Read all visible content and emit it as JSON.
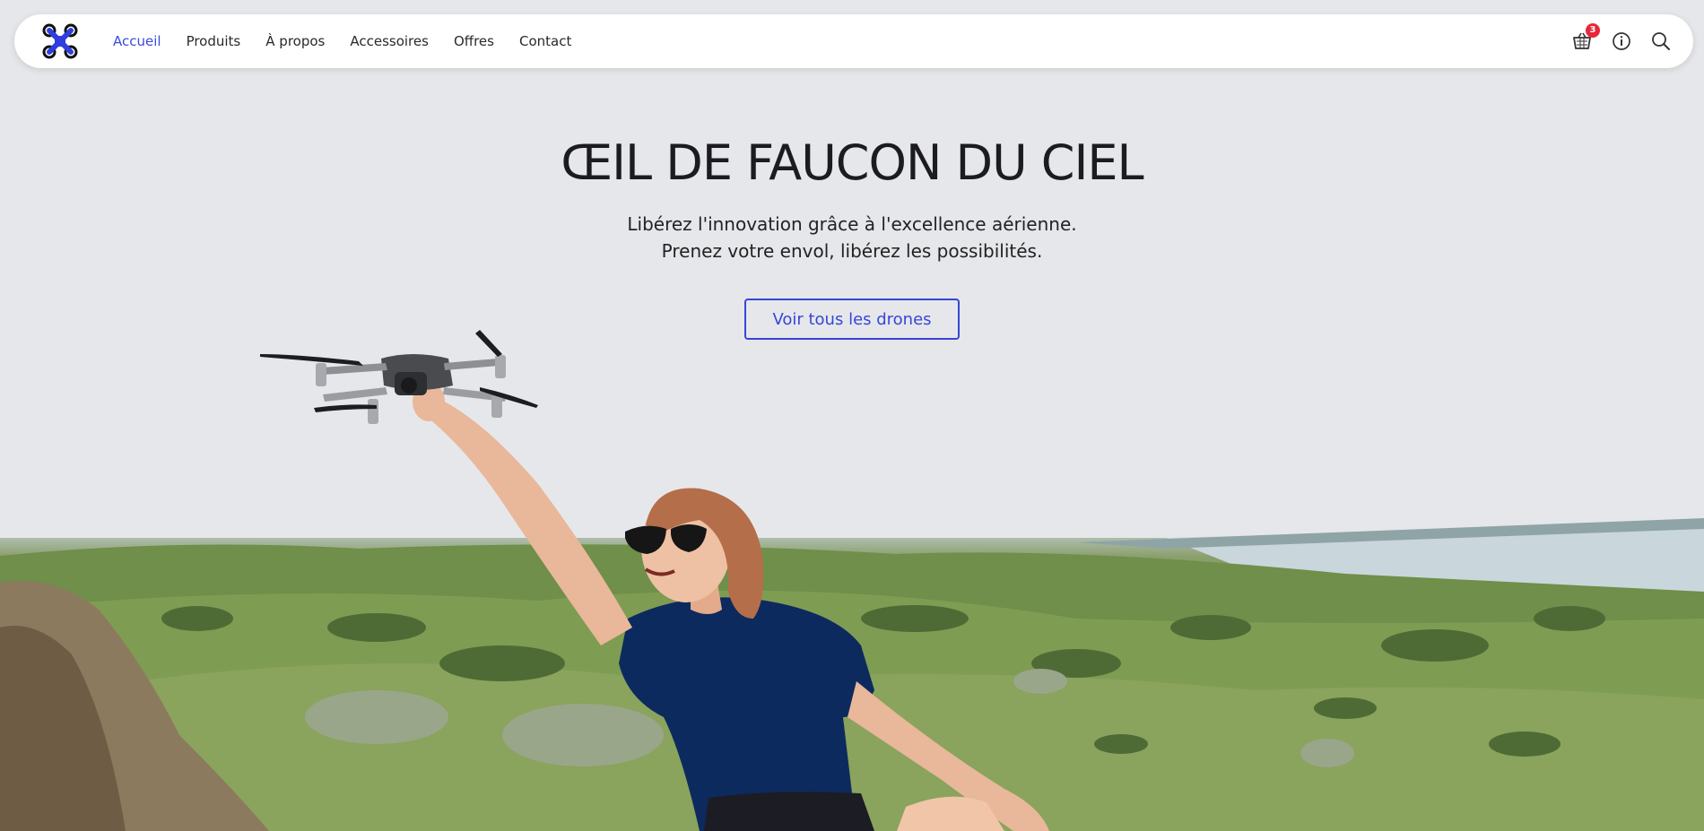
{
  "nav": {
    "logo_icon": "drone-logo-icon",
    "links": [
      {
        "label": "Accueil",
        "active": true
      },
      {
        "label": "Produits",
        "active": false
      },
      {
        "label": "À propos",
        "active": false
      },
      {
        "label": "Accessoires",
        "active": false
      },
      {
        "label": "Offres",
        "active": false
      },
      {
        "label": "Contact",
        "active": false
      }
    ],
    "cart": {
      "icon": "cart-icon",
      "count": "3"
    },
    "info_icon": "info-icon",
    "search_icon": "search-icon"
  },
  "hero": {
    "title": "ŒIL DE FAUCON DU CIEL",
    "subtitle_line1": "Libérez l'innovation grâce à l'excellence aérienne.",
    "subtitle_line2": "Prenez votre envol, libérez les possibilités.",
    "cta_label": "Voir tous les drones"
  },
  "colors": {
    "accent": "#3646d8",
    "active_link": "#3a4bdb",
    "badge": "#e8263a",
    "shirt": "#0d2a5e"
  }
}
